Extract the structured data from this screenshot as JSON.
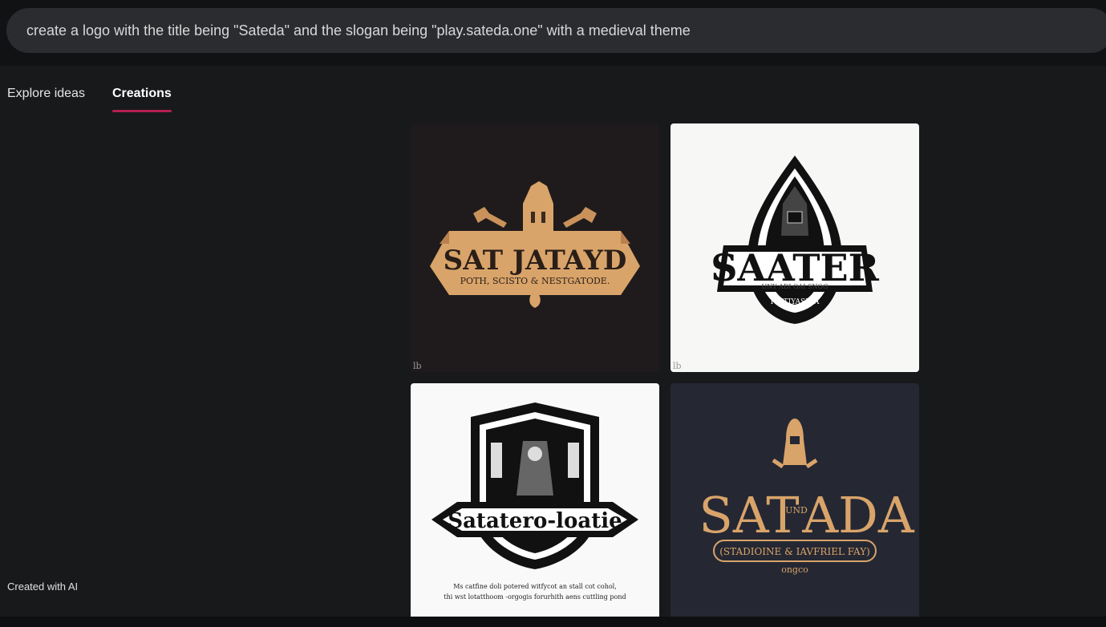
{
  "prompt": {
    "text": "create a logo with the title being \"Sateda\" and the slogan being \"play.sateda.one\" with a medieval theme"
  },
  "tabs": [
    {
      "label": "Explore ideas",
      "active": false
    },
    {
      "label": "Creations",
      "active": true
    }
  ],
  "footer": {
    "note": "Created with AI"
  },
  "images": [
    {
      "title": "SAT JATAYD",
      "subtitle": "POTH, SCISTO & NESTGATODE.",
      "corner_mark": "lb"
    },
    {
      "title": "SAATER",
      "subtitle": "UNY ADI OAI SNOG",
      "tagline": "PIETIYASH A",
      "corner_mark": "lb"
    },
    {
      "title": "Satatero-loatie",
      "caption_line1": "Ms catfine doli potered witfycot an stall cot cohol,",
      "caption_line2": "thi wst lotatthoom -orgogis forurhith aens cuttling  pond"
    },
    {
      "title_left": "SAT",
      "title_mid": "UND",
      "title_right": "ADA",
      "subtitle": "(STADIOINE & IAVFRIEL FAY)",
      "tagline": "ongco"
    }
  ],
  "colors": {
    "accent_underline": "#b3204f",
    "gold": "#d9a46a",
    "navy_card": "#252833"
  }
}
